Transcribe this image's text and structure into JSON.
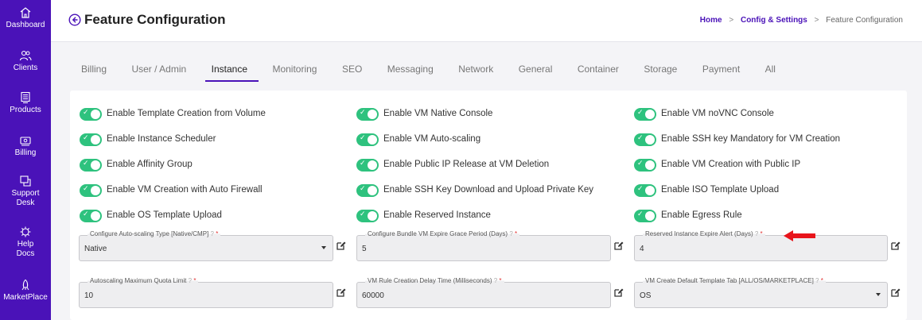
{
  "sidebar": {
    "items": [
      {
        "label": "Dashboard",
        "icon": "home-icon"
      },
      {
        "label": "Clients",
        "icon": "users-icon"
      },
      {
        "label": "Products",
        "icon": "server-icon"
      },
      {
        "label": "Billing",
        "icon": "money-icon"
      },
      {
        "label": "Support",
        "label2": "Desk",
        "icon": "support-icon"
      },
      {
        "label": "Help",
        "label2": "Docs",
        "icon": "help-icon"
      },
      {
        "label": "MarketPlace",
        "icon": "marketplace-icon"
      }
    ]
  },
  "header": {
    "title": "Feature Configuration",
    "breadcrumb": {
      "home": "Home",
      "section": "Config & Settings",
      "current": "Feature Configuration",
      "separator": ">"
    }
  },
  "tabs": [
    {
      "label": "Billing"
    },
    {
      "label": "User / Admin"
    },
    {
      "label": "Instance",
      "active": true
    },
    {
      "label": "Monitoring"
    },
    {
      "label": "SEO"
    },
    {
      "label": "Messaging"
    },
    {
      "label": "Network"
    },
    {
      "label": "General"
    },
    {
      "label": "Container"
    },
    {
      "label": "Storage"
    },
    {
      "label": "Payment"
    },
    {
      "label": "All"
    }
  ],
  "toggles": {
    "col1": [
      {
        "label": "Enable Template Creation from Volume",
        "on": true
      },
      {
        "label": "Enable Instance Scheduler",
        "on": true
      },
      {
        "label": "Enable Affinity Group",
        "on": true
      },
      {
        "label": "Enable VM Creation with Auto Firewall",
        "on": true
      },
      {
        "label": "Enable OS Template Upload",
        "on": true
      }
    ],
    "col2": [
      {
        "label": "Enable VM Native Console",
        "on": true
      },
      {
        "label": "Enable VM Auto-scaling",
        "on": true
      },
      {
        "label": "Enable Public IP Release at VM Deletion",
        "on": true
      },
      {
        "label": "Enable SSH Key Download and Upload Private Key",
        "on": true
      },
      {
        "label": "Enable Reserved Instance",
        "on": true
      }
    ],
    "col3": [
      {
        "label": "Enable VM noVNC Console",
        "on": true
      },
      {
        "label": "Enable SSH key Mandatory for VM Creation",
        "on": true
      },
      {
        "label": "Enable VM Creation with Public IP",
        "on": true
      },
      {
        "label": "Enable ISO Template Upload",
        "on": true
      },
      {
        "label": "Enable Egress Rule",
        "on": true
      }
    ]
  },
  "fields": {
    "autoscaling_type": {
      "label": "Configure Auto-scaling Type [Native/CMP]",
      "value": "Native",
      "required": "*"
    },
    "bundle_grace": {
      "label": "Configure Bundle VM Expire Grace Period (Days)",
      "value": "5",
      "required": "*"
    },
    "reserved_alert": {
      "label": "Reserved Instance Expire Alert (Days)",
      "value": "4",
      "required": "*"
    },
    "autoscaling_quota": {
      "label": "Autoscaling Maximum Quota Limit",
      "value": "10",
      "required": "*"
    },
    "rule_delay": {
      "label": "VM Rule Creation Delay Time (Milliseconds)",
      "value": "60000",
      "required": "*"
    },
    "default_tab": {
      "label": "VM Create Default Template Tab [ALL/OS/MARKETPLACE]",
      "value": "OS",
      "required": "*"
    }
  },
  "help_glyph": "?",
  "colors": {
    "sidebar": "#4a12b8",
    "accent": "#4a12b8",
    "toggle_on": "#2ec27e",
    "annotation_arrow": "#e8141b"
  }
}
